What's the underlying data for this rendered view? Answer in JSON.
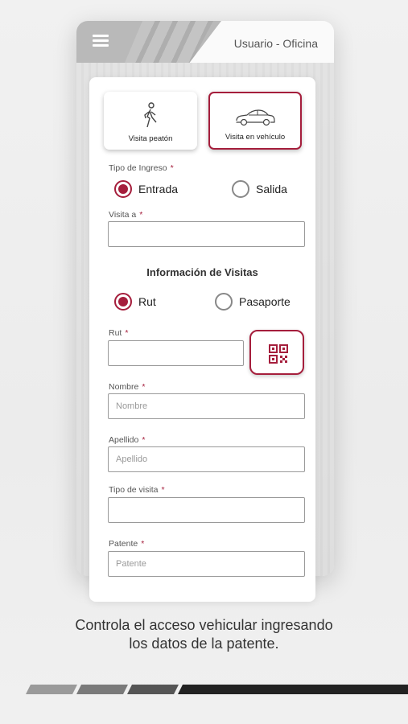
{
  "header": {
    "title": "Usuario - Oficina",
    "menu_icon": "hamburger-menu-icon"
  },
  "modes": [
    {
      "label": "Visita peatón",
      "icon": "pedestrian-icon",
      "active": false
    },
    {
      "label": "Visita en vehículo",
      "icon": "car-icon",
      "active": true
    }
  ],
  "tipo_ingreso": {
    "label": "Tipo de Ingreso",
    "required_mark": "*",
    "options": [
      {
        "label": "Entrada",
        "checked": true
      },
      {
        "label": "Salida",
        "checked": false
      }
    ]
  },
  "visita_a": {
    "label": "Visita a",
    "required_mark": "*",
    "value": ""
  },
  "info_section": {
    "title": "Información de Visitas"
  },
  "doc_type": {
    "options": [
      {
        "label": "Rut",
        "checked": true
      },
      {
        "label": "Pasaporte",
        "checked": false
      }
    ]
  },
  "rut": {
    "label": "Rut",
    "required_mark": "*",
    "value": "",
    "qr_icon": "qr-code-icon"
  },
  "nombre": {
    "label": "Nombre",
    "required_mark": "*",
    "placeholder": "Nombre"
  },
  "apellido": {
    "label": "Apellido",
    "required_mark": "*",
    "placeholder": "Apellido"
  },
  "tipo_visita": {
    "label": "Tipo de visita",
    "required_mark": "*",
    "value": ""
  },
  "patente": {
    "label": "Patente",
    "required_mark": "*",
    "placeholder": "Patente"
  },
  "caption": {
    "line1": "Controla el acceso vehicular ingresando",
    "line2": "los datos de la patente."
  },
  "colors": {
    "accent": "#a51e3c",
    "text": "#333333",
    "border": "#9a9a9a"
  }
}
